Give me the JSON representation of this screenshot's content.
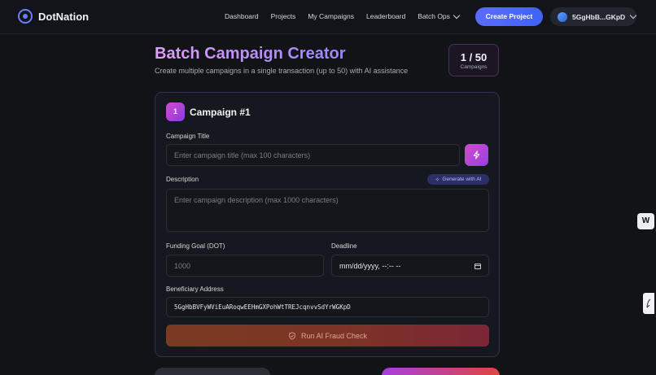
{
  "nav": {
    "brand": "DotNation",
    "links": [
      "Dashboard",
      "Projects",
      "My Campaigns",
      "Leaderboard"
    ],
    "batch_ops": "Batch Ops",
    "create_project": "Create Project",
    "wallet": "5GgHbB...GKpD"
  },
  "header": {
    "title": "Batch Campaign Creator",
    "subtitle": "Create multiple campaigns in a single transaction (up to 50) with AI assistance",
    "count": "1 / 50",
    "count_label": "Campaigns"
  },
  "campaign": {
    "number": "1",
    "title": "Campaign #1",
    "title_label": "Campaign Title",
    "title_placeholder": "Enter campaign title (max 100 characters)",
    "description_label": "Description",
    "generate_ai": "Generate with AI",
    "description_placeholder": "Enter campaign description (max 1000 characters)",
    "funding_label": "Funding Goal (DOT)",
    "funding_value": "1000",
    "deadline_label": "Deadline",
    "deadline_value": "mm/dd/yyyy, --:-- --",
    "beneficiary_label": "Beneficiary Address",
    "beneficiary_value": "5GgHbBVFyWViEuARoqwEEHmGXPohWtTREJcqnvvSdYrWGKpD",
    "fraud_check": "Run AI Fraud Check"
  },
  "widgets": {
    "side_badge": "W"
  },
  "colors": {
    "accent": "#5b6cff",
    "title_gradient_start": "#e49bff",
    "card_border": "#3d2a55",
    "fraud_button": "#7a3b22"
  }
}
